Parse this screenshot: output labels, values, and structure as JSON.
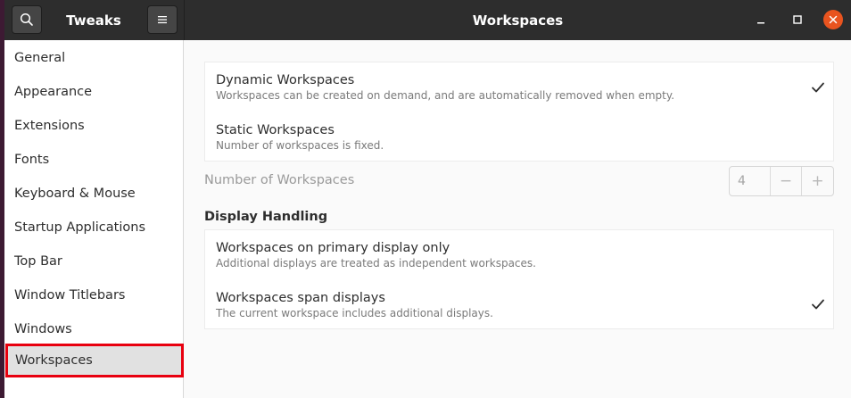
{
  "header": {
    "sidebar_title": "Tweaks",
    "title": "Workspaces",
    "search_icon": "search-icon",
    "menu_icon": "hamburger-menu-icon",
    "window_controls": [
      "minimize-icon",
      "maximize-icon",
      "close-icon"
    ],
    "close_color": "#e9541f"
  },
  "sidebar": {
    "items": [
      {
        "label": "General"
      },
      {
        "label": "Appearance"
      },
      {
        "label": "Extensions"
      },
      {
        "label": "Fonts"
      },
      {
        "label": "Keyboard & Mouse"
      },
      {
        "label": "Startup Applications"
      },
      {
        "label": "Top Bar"
      },
      {
        "label": "Window Titlebars"
      },
      {
        "label": "Windows"
      },
      {
        "label": "Workspaces",
        "selected": true
      }
    ],
    "highlight_color": "#e8000f"
  },
  "main": {
    "workspace_mode": {
      "options": [
        {
          "title": "Dynamic Workspaces",
          "subtitle": "Workspaces can be created on demand, and are automatically removed when empty.",
          "checked": true
        },
        {
          "title": "Static Workspaces",
          "subtitle": "Number of workspaces is fixed.",
          "checked": false
        }
      ]
    },
    "number_of_workspaces": {
      "label": "Number of Workspaces",
      "value": "4",
      "decrement": "−",
      "increment": "+",
      "disabled": true
    },
    "display_handling": {
      "heading": "Display Handling",
      "options": [
        {
          "title": "Workspaces on primary display only",
          "subtitle": "Additional displays are treated as independent workspaces.",
          "checked": false
        },
        {
          "title": "Workspaces span displays",
          "subtitle": "The current workspace includes additional displays.",
          "checked": true
        }
      ]
    }
  }
}
